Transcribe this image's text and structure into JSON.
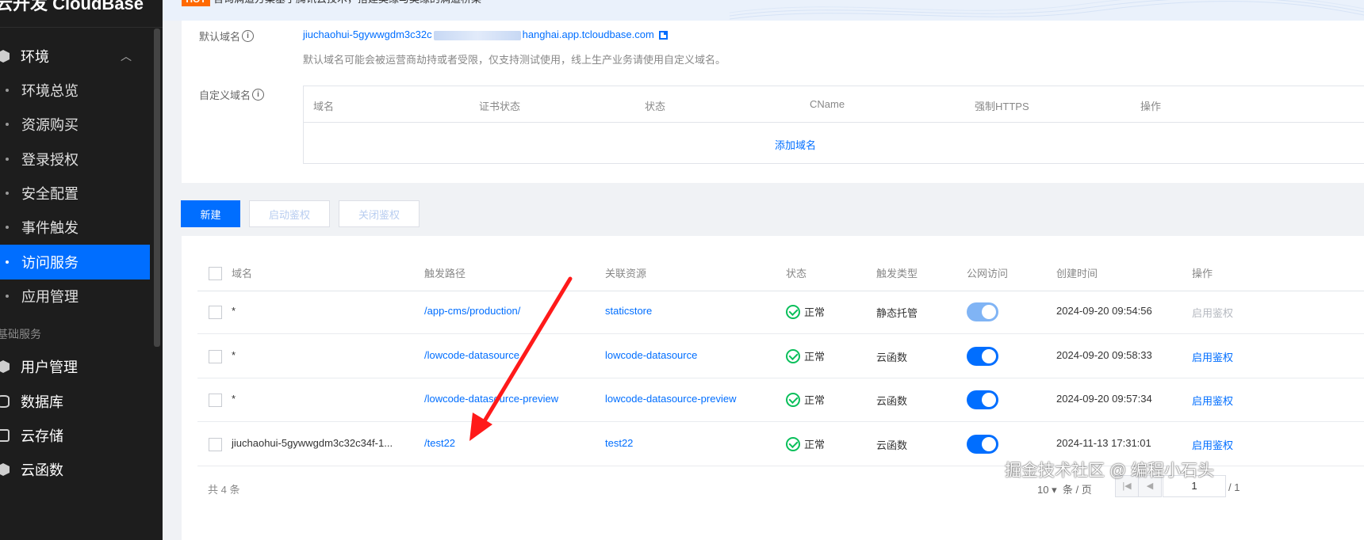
{
  "sidebar": {
    "logo": "云开发 CloudBase",
    "group_env": "环境",
    "env_items": [
      {
        "label": "环境总览"
      },
      {
        "label": "资源购买"
      },
      {
        "label": "登录授权"
      },
      {
        "label": "安全配置"
      },
      {
        "label": "事件触发"
      },
      {
        "label": "访问服务"
      },
      {
        "label": "应用管理"
      }
    ],
    "section_basic": "基础服务",
    "basic_items": [
      {
        "label": "用户管理"
      },
      {
        "label": "数据库"
      },
      {
        "label": "云存储"
      },
      {
        "label": "云函数"
      }
    ]
  },
  "banner": {
    "badge": "HOT",
    "text": "咨询满道方案基于腾讯云技术，搭建奥缘与奥缘的满道桥梁"
  },
  "domain_card": {
    "default_label": "默认域名",
    "default_domain_start": "jiuchaohui-5gywwgdm3c32c",
    "default_domain_end": "hanghai.app.tcloudbase.com",
    "default_note": "默认域名可能会被运营商劫持或者受限，仅支持测试使用，线上生产业务请使用自定义域名。",
    "custom_label": "自定义域名",
    "columns": [
      "域名",
      "证书状态",
      "状态",
      "CName",
      "强制HTTPS",
      "操作"
    ],
    "add_link": "添加域名"
  },
  "actions": {
    "new": "新建",
    "enable_auth": "启动鉴权",
    "disable_auth": "关闭鉴权"
  },
  "table": {
    "columns": {
      "domain": "域名",
      "path": "触发路径",
      "resource": "关联资源",
      "status": "状态",
      "trigger_type": "触发类型",
      "public_access": "公网访问",
      "created": "创建时间",
      "op": "操作"
    },
    "rows": [
      {
        "domain": "*",
        "path": "/app-cms/production/",
        "resource": "staticstore",
        "status": "正常",
        "type": "静态托管",
        "public_access": true,
        "created": "2024-09-20 09:54:56",
        "op": "启用鉴权"
      },
      {
        "domain": "*",
        "path": "/lowcode-datasource",
        "resource": "lowcode-datasource",
        "status": "正常",
        "type": "云函数",
        "public_access": true,
        "created": "2024-09-20 09:58:33",
        "op": "启用鉴权"
      },
      {
        "domain": "*",
        "path": "/lowcode-datasource-preview",
        "resource": "lowcode-datasource-preview",
        "status": "正常",
        "type": "云函数",
        "public_access": true,
        "created": "2024-09-20 09:57:34",
        "op": "启用鉴权"
      },
      {
        "domain": "jiuchaohui-5gywwgdm3c32c34f-1...",
        "path": "/test22",
        "resource": "test22",
        "status": "正常",
        "type": "云函数",
        "public_access": true,
        "created": "2024-11-13 17:31:01",
        "op": "启用鉴权"
      }
    ],
    "footer_total": "共  4  条",
    "page_size": "10",
    "page_size_unit": "条 / 页",
    "page_current": "1",
    "page_total": "/ 1"
  },
  "watermark": "掘金技术社区 @ 编程小石头",
  "colors": {
    "primary": "#006eff",
    "success": "#0abf5b",
    "annotation_arrow": "#ff1a1a",
    "sidebar_bg": "#1d1d1d"
  }
}
